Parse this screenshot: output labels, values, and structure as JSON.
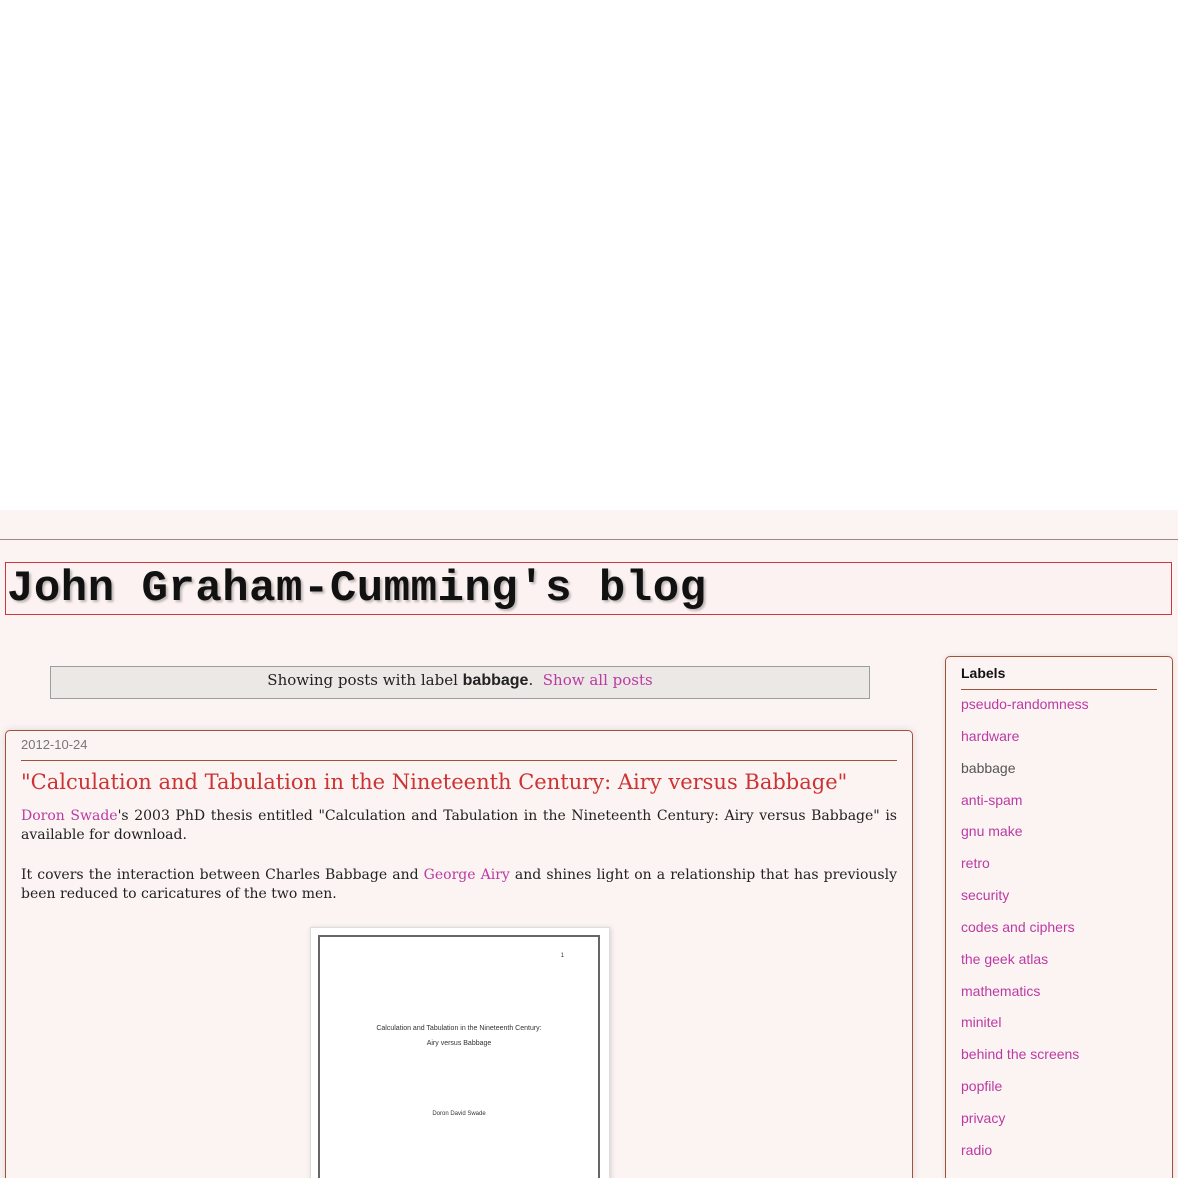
{
  "blog": {
    "title": "John Graham-Cumming's blog"
  },
  "status": {
    "prefix": "Showing posts with label ",
    "label": "babbage",
    "suffix": ".",
    "show_all": "Show all posts"
  },
  "post": {
    "date": "2012-10-24",
    "title": "\"Calculation and Tabulation in the Nineteenth Century: Airy versus Babbage\"",
    "p1_link": "Doron Swade",
    "p1_text": "'s 2003 PhD thesis entitled \"Calculation and Tabulation in the Nineteenth Century: Airy versus Babbage\" is available for download.",
    "p2_before": "It covers the interaction between Charles Babbage and ",
    "p2_link": "George Airy",
    "p2_after": " and shines light on a relationship that has previously been reduced to caricatures of the two men.",
    "thesis_image": {
      "page_number": "1",
      "title_line1": "Calculation and Tabulation in the Nineteenth Century:",
      "title_line2": "Airy versus Babbage",
      "author": "Doron David Swade"
    }
  },
  "sidebar": {
    "title": "Labels",
    "labels": [
      {
        "text": "pseudo-randomness",
        "current": false
      },
      {
        "text": "hardware",
        "current": false
      },
      {
        "text": "babbage",
        "current": true
      },
      {
        "text": "anti-spam",
        "current": false
      },
      {
        "text": "gnu make",
        "current": false
      },
      {
        "text": "retro",
        "current": false
      },
      {
        "text": "security",
        "current": false
      },
      {
        "text": "codes and ciphers",
        "current": false
      },
      {
        "text": "the geek atlas",
        "current": false
      },
      {
        "text": "mathematics",
        "current": false
      },
      {
        "text": "minitel",
        "current": false
      },
      {
        "text": "behind the screens",
        "current": false
      },
      {
        "text": "popfile",
        "current": false
      },
      {
        "text": "privacy",
        "current": false
      },
      {
        "text": "radio",
        "current": false
      }
    ]
  },
  "colors": {
    "link": "#bc3aa3",
    "post_title": "#cc3333",
    "border": "#a0533b",
    "background": "#fbf4f3"
  }
}
